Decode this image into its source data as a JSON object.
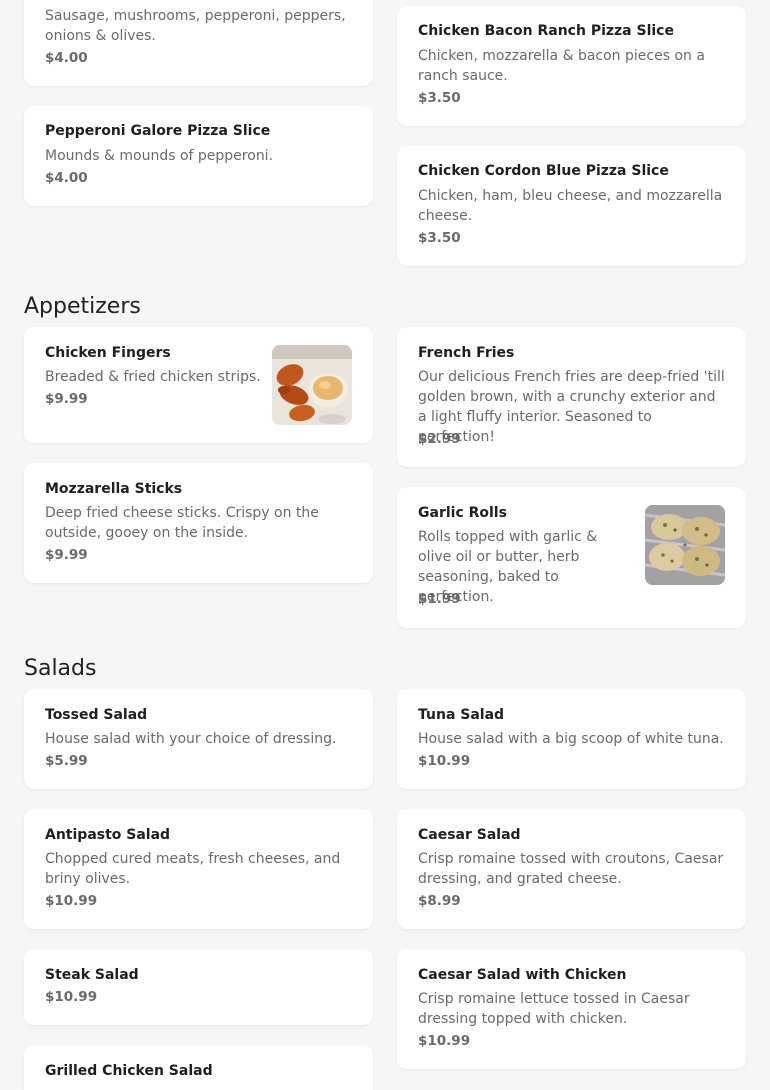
{
  "pizza": {
    "items": [
      {
        "name": "",
        "description": "Sausage, mushrooms, pepperoni, peppers, onions & olives.",
        "price": "$4.00"
      },
      {
        "name": "Chicken Bacon Ranch Pizza Slice",
        "description": "Chicken, mozzarella & bacon pieces on a ranch sauce.",
        "price": "$3.50"
      },
      {
        "name": "Pepperoni Galore Pizza Slice",
        "description": "Mounds & mounds of pepperoni.",
        "price": "$4.00"
      },
      {
        "name": "Chicken Cordon Blue Pizza Slice",
        "description": "Chicken, ham, bleu cheese, and mozzarella cheese.",
        "price": "$3.50"
      }
    ]
  },
  "appetizers": {
    "title": "Appetizers",
    "items": [
      {
        "name": "Chicken Fingers",
        "description": "Breaded & fried chicken strips.",
        "price": "$9.99",
        "image": "chicken-fingers-photo"
      },
      {
        "name": "French Fries",
        "description": "Our delicious French fries are deep-fried 'till golden brown, with a crunchy exterior and a light fluffy interior. Seasoned to perfection!",
        "price": "$2.99"
      },
      {
        "name": "Mozzarella Sticks",
        "description": "Deep fried cheese sticks. Crispy on the outside, gooey on the inside.",
        "price": "$9.99"
      },
      {
        "name": "Garlic Rolls",
        "description": "Rolls topped with garlic & olive oil or butter, herb seasoning, baked to perfection.",
        "price": "$1.99",
        "image": "garlic-rolls-photo"
      }
    ]
  },
  "salads": {
    "title": "Salads",
    "items": [
      {
        "name": "Tossed Salad",
        "description": "House salad with your choice of dressing.",
        "price": "$5.99"
      },
      {
        "name": "Tuna Salad",
        "description": "House salad with a big scoop of white tuna.",
        "price": "$10.99"
      },
      {
        "name": "Antipasto Salad",
        "description": "Chopped cured meats, fresh cheeses, and briny olives.",
        "price": "$10.99"
      },
      {
        "name": "Caesar Salad",
        "description": "Crisp romaine tossed with croutons, Caesar dressing, and grated cheese.",
        "price": "$8.99"
      },
      {
        "name": "Steak Salad",
        "description": "",
        "price": "$10.99"
      },
      {
        "name": "Caesar Salad with Chicken",
        "description": "Crisp romaine lettuce tossed in Caesar dressing topped with chicken.",
        "price": "$10.99"
      },
      {
        "name": "Grilled Chicken Salad",
        "description": "",
        "price": ""
      }
    ]
  }
}
